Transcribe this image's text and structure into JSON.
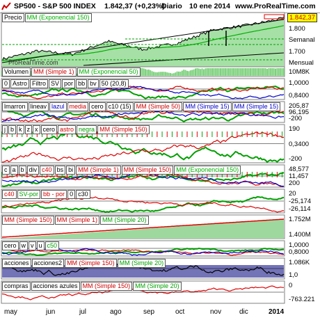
{
  "header": {
    "symbol": "SP500 - S&P 500 INDEX",
    "last": "1.842,37 (+0,23%)",
    "period": "Diario",
    "date": "10 ene 2014",
    "site": "www.ProRealTime.com"
  },
  "colors": {
    "price_fill": "#90d890",
    "price_line": "#000000",
    "volume_fill": "#7ad07a",
    "red": "#e00000",
    "green": "#00a000",
    "blue": "#0000cc",
    "purple": "#7373b8",
    "badge_yellow": "#ffff00"
  },
  "panels": [
    {
      "id": "price",
      "tags": [
        "Precio",
        "MM (Exponencial 150)"
      ],
      "right_labels": [
        "1.842,37",
        "1.800",
        "Semanal",
        "1.700",
        "Mensual"
      ],
      "watermark": "ProRealTime.com"
    },
    {
      "id": "volume",
      "tags": [
        "Volumen",
        "MM (Simple 1)",
        "MM (Exponencial 50)"
      ],
      "right_labels": [
        "10M8K"
      ]
    },
    {
      "id": "astro",
      "tags": [
        "0",
        "Astro",
        "Filtro",
        "SV",
        "por",
        "bb",
        "bv",
        "50 (20,8)"
      ],
      "right_labels": [
        "1,0000",
        "0,8400"
      ]
    },
    {
      "id": "lmarron",
      "tags": [
        "lmarron",
        "lineav",
        "lazul",
        "media",
        "cero",
        "c10 (15)",
        "MM (Simple 50)",
        "MM (Simple 15)",
        "MM (Simple 15)"
      ],
      "right_labels": [
        "205,87",
        "96,195",
        "-200"
      ]
    },
    {
      "id": "astro2",
      "tags": [
        "j",
        "b",
        "k",
        "z",
        "x",
        "cero",
        "astro",
        "negra",
        "MM (Simple 150)"
      ],
      "right_labels": [
        "190",
        "0,3400",
        "-200"
      ]
    },
    {
      "id": "c4",
      "tags": [
        "c",
        "a",
        "b",
        "div",
        "c40",
        "bs",
        "bi",
        "MM (Simple 1)",
        "MM (Simple 150)",
        "MM (Exponencial 150)"
      ],
      "right_labels": [
        "48,577",
        "11,457",
        "200"
      ]
    },
    {
      "id": "sv",
      "tags": [
        "c40",
        "SV-por",
        "bb - por",
        "0",
        "c30"
      ],
      "right_labels": [
        "20",
        "-25,174",
        "-26,114"
      ]
    },
    {
      "id": "mm150",
      "tags": [
        "MM (Simple 150)",
        "MM (Simple 1)",
        "MM (Simple 20)"
      ],
      "right_labels": [
        "1.752M",
        "1.400M"
      ]
    },
    {
      "id": "cero",
      "tags": [
        "cero",
        "w",
        "v",
        "u",
        "c50"
      ],
      "right_labels": [
        "1,0000",
        "0,8000"
      ]
    },
    {
      "id": "acciones",
      "tags": [
        "acciones",
        "acciones2",
        "MM (Simple 150)",
        "MM (Simple 20)"
      ],
      "right_labels": [
        "1.086K",
        "1,0"
      ]
    },
    {
      "id": "compras",
      "tags": [
        "compras",
        "acciones azules",
        "MM (Simple 150)",
        "MM (Simple 20)"
      ],
      "right_labels": [
        "0",
        "-763.221"
      ]
    }
  ],
  "x_axis": [
    "may",
    "jun",
    "jul",
    "ago",
    "sep",
    "oct",
    "nov",
    "dic",
    "2014"
  ],
  "chart_data": {
    "type": "line",
    "title": "SP500 - S&P 500 INDEX",
    "x": [
      "may",
      "jun",
      "jul",
      "ago",
      "sep",
      "oct",
      "nov",
      "dic",
      "2014"
    ],
    "series": [
      {
        "name": "Precio",
        "values": [
          1590,
          1640,
          1620,
          1700,
          1650,
          1690,
          1770,
          1800,
          1842.37
        ]
      }
    ],
    "ylim": [
      1560,
      1860
    ],
    "last_value": 1842.37,
    "change_pct": 0.23
  }
}
